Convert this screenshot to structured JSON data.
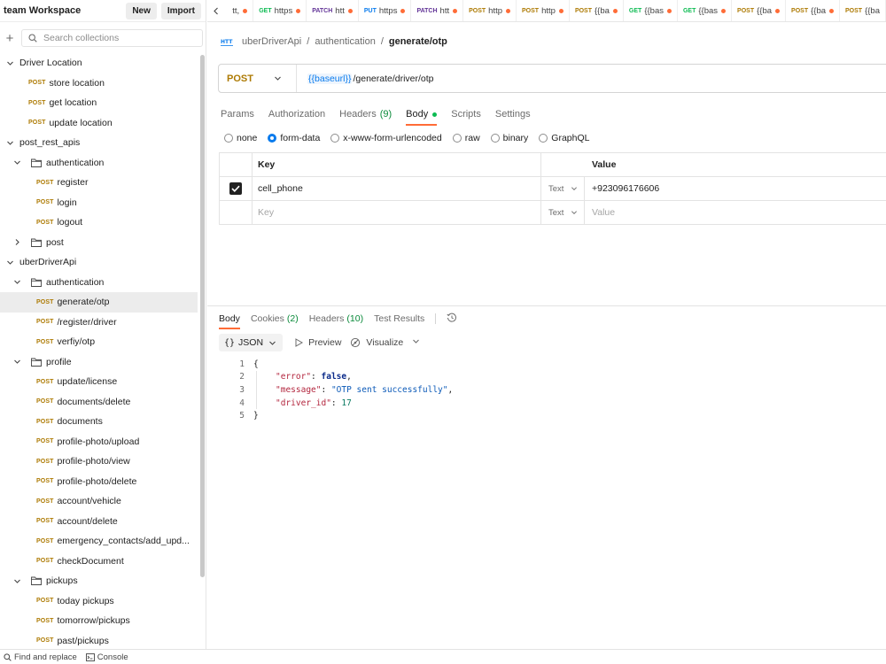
{
  "workspace": {
    "title": "team Workspace",
    "new_label": "New",
    "import_label": "Import",
    "search_placeholder": "Search collections"
  },
  "sidebar": {
    "collections": [
      {
        "name": "Driver Location",
        "requests": [
          {
            "method": "POST",
            "name": "store location"
          },
          {
            "method": "POST",
            "name": "get location"
          },
          {
            "method": "POST",
            "name": "update location"
          }
        ]
      },
      {
        "name": "post_rest_apis",
        "folders": [
          {
            "name": "authentication",
            "requests": [
              {
                "method": "POST",
                "name": "register"
              },
              {
                "method": "POST",
                "name": "login"
              },
              {
                "method": "POST",
                "name": "logout"
              }
            ]
          },
          {
            "name": "post"
          }
        ]
      },
      {
        "name": "uberDriverApi",
        "folders": [
          {
            "name": "authentication",
            "requests": [
              {
                "method": "POST",
                "name": "generate/otp"
              },
              {
                "method": "POST",
                "name": "/register/driver"
              },
              {
                "method": "POST",
                "name": "verfiy/otp"
              }
            ]
          },
          {
            "name": "profile",
            "requests": [
              {
                "method": "POST",
                "name": "update/license"
              },
              {
                "method": "POST",
                "name": "documents/delete"
              },
              {
                "method": "POST",
                "name": "documents"
              },
              {
                "method": "POST",
                "name": "profile-photo/upload"
              },
              {
                "method": "POST",
                "name": "profile-photo/view"
              },
              {
                "method": "POST",
                "name": "profile-photo/delete"
              },
              {
                "method": "POST",
                "name": "account/vehicle"
              },
              {
                "method": "POST",
                "name": "account/delete"
              },
              {
                "method": "POST",
                "name": "emergency_contacts/add_upd..."
              },
              {
                "method": "POST",
                "name": "checkDocument"
              }
            ]
          },
          {
            "name": "pickups",
            "requests": [
              {
                "method": "POST",
                "name": "today pickups"
              },
              {
                "method": "POST",
                "name": "tomorrow/pickups"
              },
              {
                "method": "POST",
                "name": "past/pickups"
              }
            ]
          }
        ]
      }
    ]
  },
  "tabs": [
    {
      "method": "",
      "label": "tt,",
      "method_color": "#6b6b6b"
    },
    {
      "method": "GET",
      "label": "https",
      "method_color": "#0cbb52"
    },
    {
      "method": "PATCH",
      "label": "htt",
      "method_color": "#623497"
    },
    {
      "method": "PUT",
      "label": "https",
      "method_color": "#097bed"
    },
    {
      "method": "PATCH",
      "label": "htt",
      "method_color": "#623497"
    },
    {
      "method": "POST",
      "label": "http",
      "method_color": "#ad7a03"
    },
    {
      "method": "POST",
      "label": "http",
      "method_color": "#ad7a03"
    },
    {
      "method": "POST",
      "label": "{{ba",
      "method_color": "#ad7a03"
    },
    {
      "method": "GET",
      "label": "{{bas",
      "method_color": "#0cbb52"
    },
    {
      "method": "GET",
      "label": "{{bas",
      "method_color": "#0cbb52"
    },
    {
      "method": "POST",
      "label": "{{ba",
      "method_color": "#ad7a03"
    },
    {
      "method": "POST",
      "label": "{{ba",
      "method_color": "#ad7a03"
    },
    {
      "method": "POST",
      "label": "{{ba",
      "method_color": "#ad7a03"
    }
  ],
  "breadcrumb": {
    "collection": "uberDriverApi",
    "folder": "authentication",
    "request": "generate/otp",
    "separator": "/"
  },
  "request": {
    "method": "POST",
    "url_variable": "{{baseurl}}",
    "url_path": "/generate/driver/otp",
    "tabs": [
      {
        "label": "Params",
        "count": ""
      },
      {
        "label": "Authorization",
        "count": ""
      },
      {
        "label": "Headers",
        "count": "(9)"
      },
      {
        "label": "Body",
        "count": ""
      },
      {
        "label": "Scripts",
        "count": ""
      },
      {
        "label": "Settings",
        "count": ""
      }
    ],
    "active_tab": "Body",
    "body_types": [
      "none",
      "form-data",
      "x-www-form-urlencoded",
      "raw",
      "binary",
      "GraphQL"
    ],
    "selected_body_type": "form-data",
    "table": {
      "headers": {
        "key": "Key",
        "value": "Value"
      },
      "rows": [
        {
          "checked": true,
          "key": "cell_phone",
          "type": "Text",
          "value": "+923096176606"
        }
      ],
      "placeholder": {
        "key": "Key",
        "type": "Text",
        "value": "Value"
      }
    }
  },
  "response": {
    "tabs": [
      {
        "label": "Body",
        "count": ""
      },
      {
        "label": "Cookies",
        "count": "(2)"
      },
      {
        "label": "Headers",
        "count": "(10)"
      },
      {
        "label": "Test Results",
        "count": ""
      }
    ],
    "active_tab": "Body",
    "format": "JSON",
    "preview_label": "Preview",
    "visualize_label": "Visualize",
    "json": {
      "error": false,
      "message": "OTP sent successfully",
      "driver_id": 17
    }
  },
  "status_bar": {
    "find_replace": "Find and replace",
    "console": "Console"
  },
  "colors": {
    "accent": "#ff6c37",
    "post": "#ad7a03",
    "selected_radio": "#097bed"
  }
}
